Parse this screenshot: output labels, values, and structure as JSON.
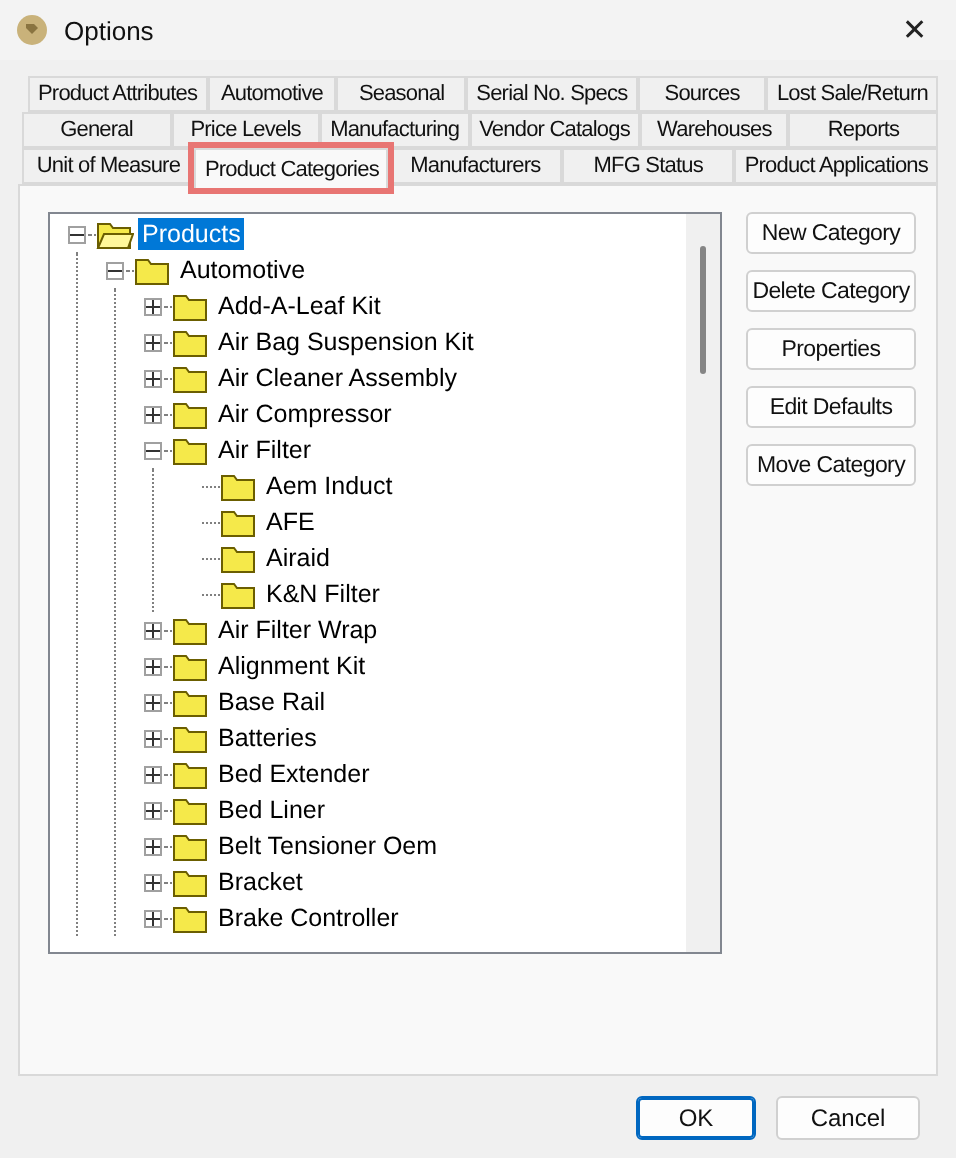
{
  "window": {
    "title": "Options",
    "close": "✕"
  },
  "tab_rows": [
    {
      "tabs": [
        {
          "label": "Product Attributes",
          "selected": false
        },
        {
          "label": "Automotive",
          "selected": false
        },
        {
          "label": "Seasonal",
          "selected": false
        },
        {
          "label": "Serial No. Specs",
          "selected": false
        },
        {
          "label": "Sources",
          "selected": false
        },
        {
          "label": "Lost Sale/Return",
          "selected": false
        }
      ]
    },
    {
      "tabs": [
        {
          "label": "General",
          "selected": false
        },
        {
          "label": "Price Levels",
          "selected": false
        },
        {
          "label": "Manufacturing",
          "selected": false
        },
        {
          "label": "Vendor Catalogs",
          "selected": false
        },
        {
          "label": "Warehouses",
          "selected": false
        },
        {
          "label": "Reports",
          "selected": false
        }
      ]
    },
    {
      "tabs": [
        {
          "label": "Unit of Measure",
          "selected": false
        },
        {
          "label": "Product Categories",
          "selected": true,
          "highlighted": true
        },
        {
          "label": "Manufacturers",
          "selected": false
        },
        {
          "label": "MFG Status",
          "selected": false
        },
        {
          "label": "Product Applications",
          "selected": false
        }
      ]
    }
  ],
  "tree": [
    {
      "label": "Products",
      "selected": true,
      "expanded": true,
      "children": [
        {
          "label": "Automotive",
          "selected": false,
          "expanded": true,
          "children": [
            {
              "label": "Add-A-Leaf Kit",
              "selected": false,
              "expanded": false
            },
            {
              "label": "Air Bag Suspension Kit",
              "selected": false,
              "expanded": false
            },
            {
              "label": "Air Cleaner Assembly",
              "selected": false,
              "expanded": false
            },
            {
              "label": "Air Compressor",
              "selected": false,
              "expanded": false
            },
            {
              "label": "Air Filter",
              "selected": false,
              "expanded": true,
              "children": [
                {
                  "label": "Aem Induct",
                  "selected": false
                },
                {
                  "label": "AFE",
                  "selected": false
                },
                {
                  "label": "Airaid",
                  "selected": false
                },
                {
                  "label": "K&N Filter",
                  "selected": false
                }
              ]
            },
            {
              "label": "Air Filter Wrap",
              "selected": false,
              "expanded": false
            },
            {
              "label": "Alignment Kit",
              "selected": false,
              "expanded": false
            },
            {
              "label": "Base Rail",
              "selected": false,
              "expanded": false
            },
            {
              "label": "Batteries",
              "selected": false,
              "expanded": false
            },
            {
              "label": "Bed Extender",
              "selected": false,
              "expanded": false
            },
            {
              "label": "Bed Liner",
              "selected": false,
              "expanded": false
            },
            {
              "label": "Belt Tensioner Oem",
              "selected": false,
              "expanded": false
            },
            {
              "label": "Bracket",
              "selected": false,
              "expanded": false
            },
            {
              "label": "Brake Controller",
              "selected": false,
              "expanded": false
            }
          ]
        }
      ]
    }
  ],
  "side_buttons": [
    "New Category",
    "Delete Category",
    "Properties",
    "Edit Defaults",
    "Move Category"
  ],
  "footer_buttons": [
    {
      "label": "OK",
      "default": true
    },
    {
      "label": "Cancel",
      "default": false
    }
  ]
}
